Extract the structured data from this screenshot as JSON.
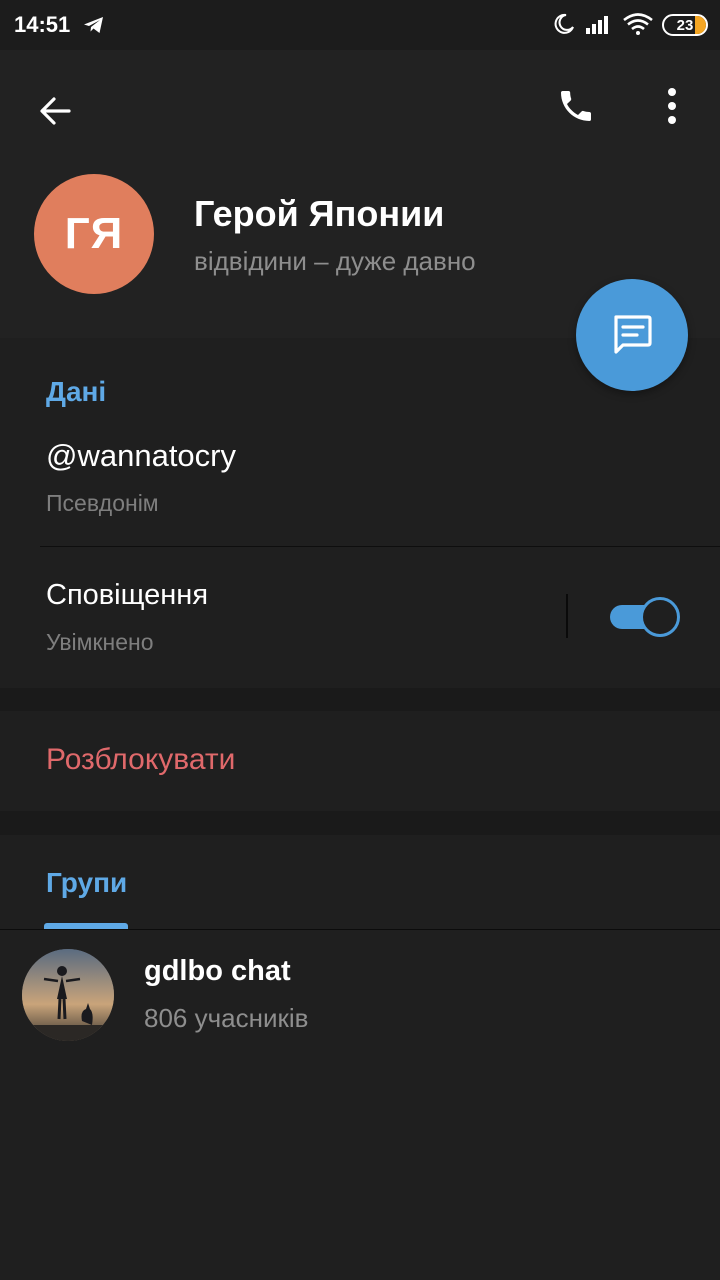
{
  "status_bar": {
    "time": "14:51",
    "battery": "23",
    "icons": [
      "telegram-icon",
      "moon-icon",
      "signal-icon",
      "wifi-icon",
      "battery-icon"
    ]
  },
  "header": {
    "avatar_initials": "ГЯ",
    "name": "Герой Японии",
    "status": "відвідини – дуже давно",
    "avatar_color": "#e07e5d"
  },
  "info": {
    "section_title": "Дані",
    "username": "@wannatocry",
    "username_label": "Псевдонім",
    "notifications_title": "Сповіщення",
    "notifications_status": "Увімкнено",
    "notifications_enabled": true
  },
  "actions": {
    "unblock": "Розблокувати"
  },
  "groups": {
    "section_title": "Групи",
    "items": [
      {
        "name": "gdlbo chat",
        "members": "806 учасників"
      }
    ]
  },
  "colors": {
    "accent": "#5fa9e6",
    "fab": "#4a9ad9",
    "danger": "#e0696b",
    "background": "#1a1a1a"
  }
}
